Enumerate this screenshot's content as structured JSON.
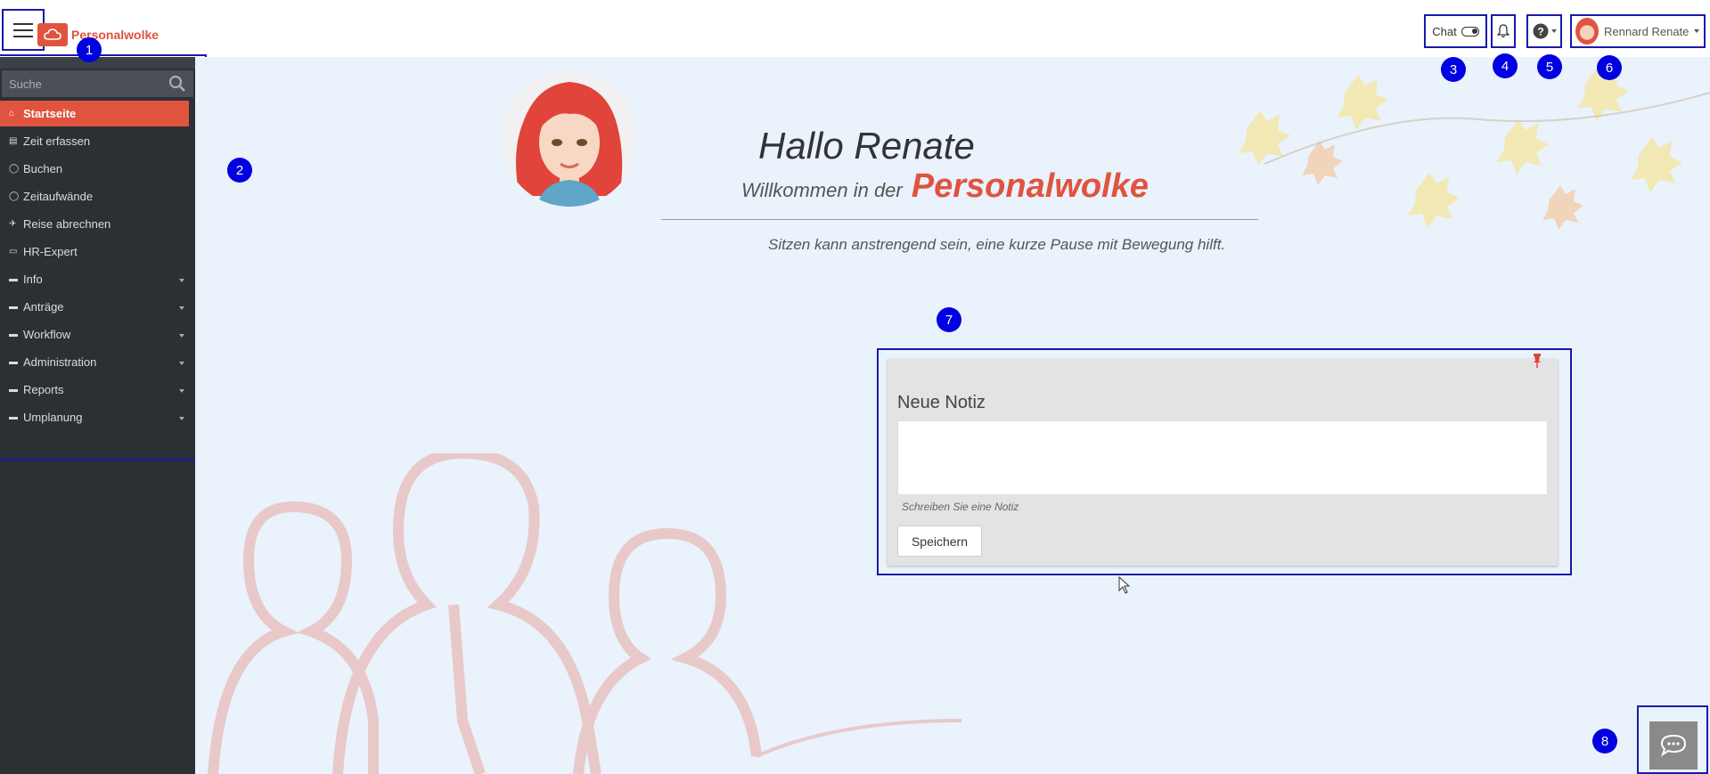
{
  "header": {
    "brand": "Personalwolke",
    "chat_label": "Chat",
    "user_name": "Rennard Renate"
  },
  "sidebar": {
    "search_placeholder": "Suche",
    "items": [
      {
        "label": "Startseite",
        "icon": "home-icon"
      },
      {
        "label": "Zeit erfassen",
        "icon": "list-icon"
      },
      {
        "label": "Buchen",
        "icon": "clock-icon"
      },
      {
        "label": "Zeitaufwände",
        "icon": "clock-icon"
      },
      {
        "label": "Reise abrechnen",
        "icon": "plane-icon"
      },
      {
        "label": "HR-Expert",
        "icon": "monitor-icon"
      },
      {
        "label": "Info",
        "icon": "folder-icon"
      },
      {
        "label": "Anträge",
        "icon": "folder-icon"
      },
      {
        "label": "Workflow",
        "icon": "folder-icon"
      },
      {
        "label": "Administration",
        "icon": "folder-icon"
      },
      {
        "label": "Reports",
        "icon": "folder-icon"
      },
      {
        "label": "Umplanung",
        "icon": "folder-icon"
      }
    ]
  },
  "welcome": {
    "hallo": "Hallo Renate",
    "prefix": "Willkommen in der",
    "brand": "Personalwolke",
    "tip": "Sitzen kann anstrengend sein, eine kurze Pause mit Bewegung hilft."
  },
  "note": {
    "title": "Neue Notiz",
    "hint": "Schreiben Sie eine Notiz",
    "save_label": "Speichern"
  },
  "markers": [
    "1",
    "2",
    "3",
    "4",
    "5",
    "6",
    "7",
    "8"
  ],
  "colors": {
    "accent": "#e0533f",
    "sidebar_bg": "#2b3035",
    "main_bg": "#eaf2fc",
    "marker": "#0000e0",
    "outline": "#1a1aa8"
  }
}
